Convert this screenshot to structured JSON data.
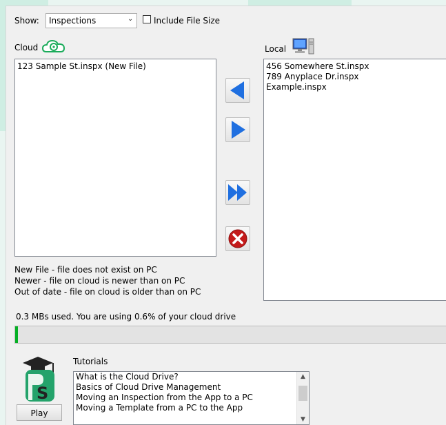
{
  "show": {
    "label": "Show:",
    "selected": "Inspections"
  },
  "include_file_size": {
    "label": "Include File Size",
    "checked": false
  },
  "cloud": {
    "label": "Cloud",
    "items": [
      "123 Sample St.inspx (New File)"
    ]
  },
  "local": {
    "label": "Local",
    "items": [
      "456 Somewhere St.inspx",
      "789 Anyplace Dr.inspx",
      "Example.inspx"
    ]
  },
  "buttons": {
    "download": "arrow-left-icon",
    "upload": "arrow-right-icon",
    "upload_all": "double-arrow-right-icon",
    "delete": "delete-x-icon"
  },
  "legend": [
    "New File - file does not exist on PC",
    "Newer - file on cloud is newer than on PC",
    "Out of date - file on cloud is older than on PC"
  ],
  "usage": {
    "text": "0.3 MBs used.  You are using  0.6% of your cloud drive",
    "percent": 0.6
  },
  "tutorials": {
    "label": "Tutorials",
    "items": [
      "What is the Cloud Drive?",
      "Basics of Cloud Drive Management",
      "Moving an Inspection from the App to a PC",
      "Moving a Template from a PC to the App"
    ]
  },
  "play_button": "Play",
  "colors": {
    "arrow": "#1f6fe0",
    "delete": "#c41a1a",
    "cloud_icon": "#1aab5a",
    "progress": "#06b025"
  }
}
